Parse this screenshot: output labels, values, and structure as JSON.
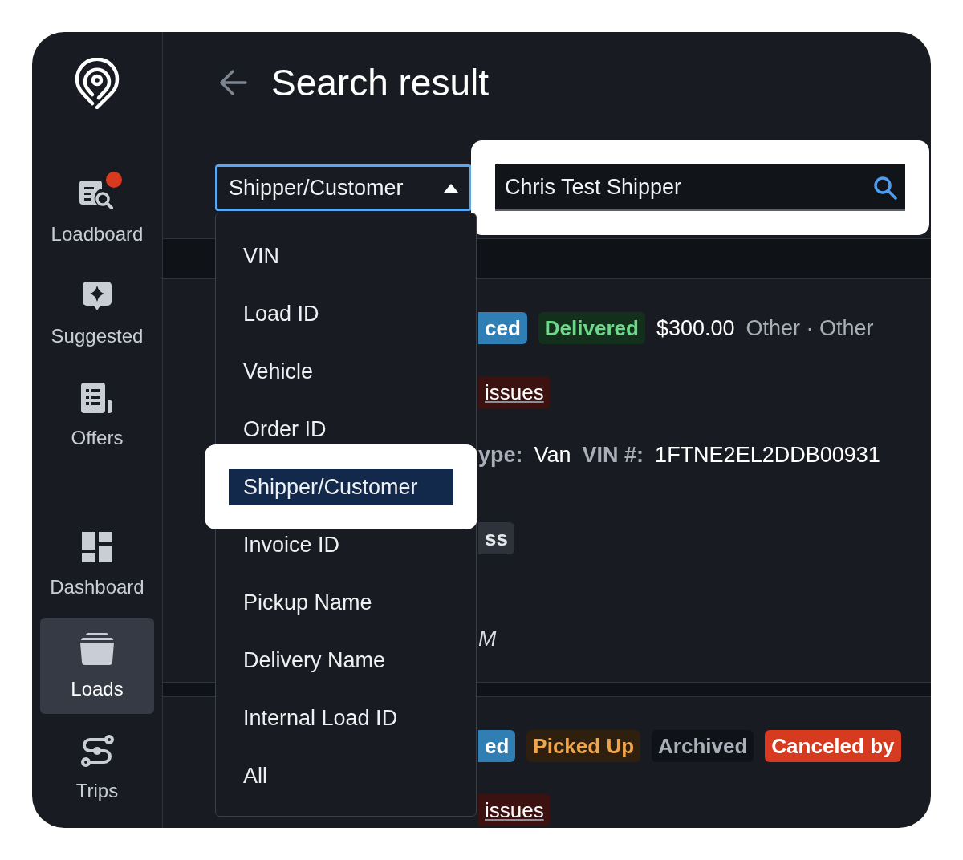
{
  "sidebar": {
    "groups": [
      {
        "items": [
          {
            "label": "Loadboard",
            "notification": true,
            "selected": false
          },
          {
            "label": "Suggested",
            "notification": false,
            "selected": false
          },
          {
            "label": "Offers",
            "notification": false,
            "selected": false
          }
        ]
      },
      {
        "items": [
          {
            "label": "Dashboard",
            "notification": false,
            "selected": false
          },
          {
            "label": "Loads",
            "notification": false,
            "selected": true
          },
          {
            "label": "Trips",
            "notification": false,
            "selected": false
          }
        ]
      }
    ]
  },
  "header": {
    "title": "Search result"
  },
  "search": {
    "filter": {
      "value": "Shipper/Customer",
      "expanded": true
    },
    "query": {
      "value": "Chris Test Shipper"
    }
  },
  "dropdown": {
    "options": [
      {
        "label": "VIN",
        "selected": false
      },
      {
        "label": "Load ID",
        "selected": false
      },
      {
        "label": "Vehicle",
        "selected": false
      },
      {
        "label": "Order ID",
        "selected": false
      },
      {
        "label": "Shipper/Customer",
        "selected": true
      },
      {
        "label": "Invoice ID",
        "selected": false
      },
      {
        "label": "Pickup Name",
        "selected": false
      },
      {
        "label": "Delivery Name",
        "selected": false
      },
      {
        "label": "Internal Load ID",
        "selected": false
      },
      {
        "label": "All",
        "selected": false
      }
    ]
  },
  "results": [
    {
      "lines": [
        {
          "items": [
            {
              "kind": "info",
              "text": "ced"
            },
            {
              "kind": "success",
              "text": "Delivered"
            },
            {
              "kind": "amount",
              "text": "$300.00"
            },
            {
              "kind": "meta",
              "text": "Other · Other"
            }
          ]
        },
        {
          "items": [
            {
              "kind": "danger",
              "text": "issues"
            }
          ]
        },
        {
          "items": [
            {
              "kind": "label",
              "text": "ype:"
            },
            {
              "kind": "value",
              "text": "Van"
            },
            {
              "kind": "label",
              "text": "VIN #:"
            },
            {
              "kind": "value",
              "text": "1FTNE2EL2DDB00931"
            }
          ]
        },
        {
          "items": [
            {
              "kind": "neutral",
              "text": "ss"
            }
          ]
        },
        {
          "items": [
            {
              "kind": "note",
              "text": "M"
            }
          ]
        }
      ]
    },
    {
      "lines": [
        {
          "items": [
            {
              "kind": "info",
              "text": "ed"
            },
            {
              "kind": "warning",
              "text": "Picked Up"
            },
            {
              "kind": "muted",
              "text": "Archived"
            },
            {
              "kind": "alert",
              "text": "Canceled by"
            }
          ]
        },
        {
          "items": [
            {
              "kind": "danger",
              "text": "issues"
            }
          ]
        }
      ]
    }
  ]
}
